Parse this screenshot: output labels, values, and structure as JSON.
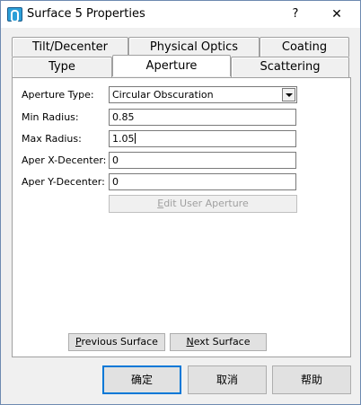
{
  "window": {
    "title": "Surface 5 Properties",
    "help_label": "?",
    "close_label": "✕"
  },
  "tabs_back": [
    {
      "label": "Tilt/Decenter"
    },
    {
      "label": "Physical Optics"
    },
    {
      "label": "Coating"
    }
  ],
  "tabs_front": [
    {
      "label": "Type"
    },
    {
      "label": "Aperture"
    },
    {
      "label": "Scattering"
    }
  ],
  "form": {
    "aperture_type_label": "Aperture Type:",
    "aperture_type_value": "Circular Obscuration",
    "min_radius_label": "Min Radius:",
    "min_radius_value": "0.85",
    "max_radius_label": "Max Radius:",
    "max_radius_value": "1.05",
    "aper_x_label": "Aper X-Decenter:",
    "aper_x_value": "0",
    "aper_y_label": "Aper Y-Decenter:",
    "aper_y_value": "0",
    "edit_user_aperture": {
      "prefix": "E",
      "rest": "dit User Aperture"
    }
  },
  "nav": {
    "previous": {
      "prefix": "P",
      "rest": "revious Surface"
    },
    "next": {
      "prefix": "N",
      "rest": "ext Surface"
    }
  },
  "dialog_buttons": {
    "ok": "确定",
    "cancel": "取消",
    "help": "帮助"
  }
}
